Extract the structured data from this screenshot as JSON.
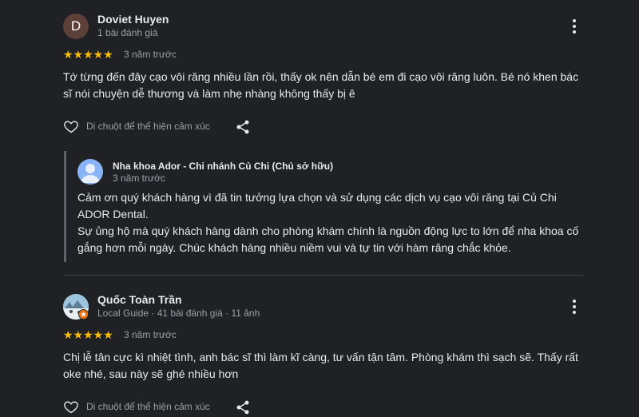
{
  "reviews": [
    {
      "author": "Doviet Huyen",
      "avatar_letter": "D",
      "meta": "1 bài đánh giá",
      "stars": "★★★★★",
      "time": "3 năm trước",
      "text": "Tớ từng đến đây cạo vôi răng nhiều lần rồi, thấy ok nên dẫn bé em đi cạo vôi răng luôn. Bé nó khen bác sĩ nói chuyện dễ thương và làm nhẹ nhàng không thấy bị ê",
      "react_label": "Di chuột để thể hiện cảm xúc",
      "owner_reply": {
        "name": "Nha khoa Ador - Chi nhánh Củ Chi (Chủ sở hữu)",
        "time": "3 năm trước",
        "text_line1": "Cảm ơn quý khách hàng vì đã tin tưởng lựa chọn và sử dụng các dịch vụ cạo vôi răng tại Củ Chi ADOR Dental.",
        "text_line2": "Sự ủng hộ mà quý khách hàng dành cho phòng khám chính là nguồn động lực to lớn để nha khoa cố gắng hơn mỗi ngày. Chúc khách hàng nhiều niềm vui và tự tin với hàm răng chắc khỏe."
      }
    },
    {
      "author": "Quốc Toàn Trần",
      "meta": "Local Guide · 41 bài đánh giá · 11 ảnh",
      "stars": "★★★★★",
      "time": "3 năm trước",
      "text": "Chị lễ tân cực kì nhiệt tình, anh bác sĩ thì làm kĩ càng, tư vấn tận tâm. Phòng khám thì sạch sẽ. Thấy rất oke nhé, sau này sẽ ghé nhiều hơn",
      "react_label": "Di chuột để thể hiện cảm xúc"
    }
  ],
  "colors": {
    "background": "#202124",
    "star": "#fbbc04",
    "avatar_d": "#5d4037",
    "owner_avatar": "#8ab4f8",
    "local_guide_badge": "#e8710a"
  },
  "icons": {
    "more": "more-vert-icon",
    "heart": "heart-outline-icon",
    "share": "share-icon",
    "person": "person-icon",
    "badge": "local-guide-star-icon"
  }
}
